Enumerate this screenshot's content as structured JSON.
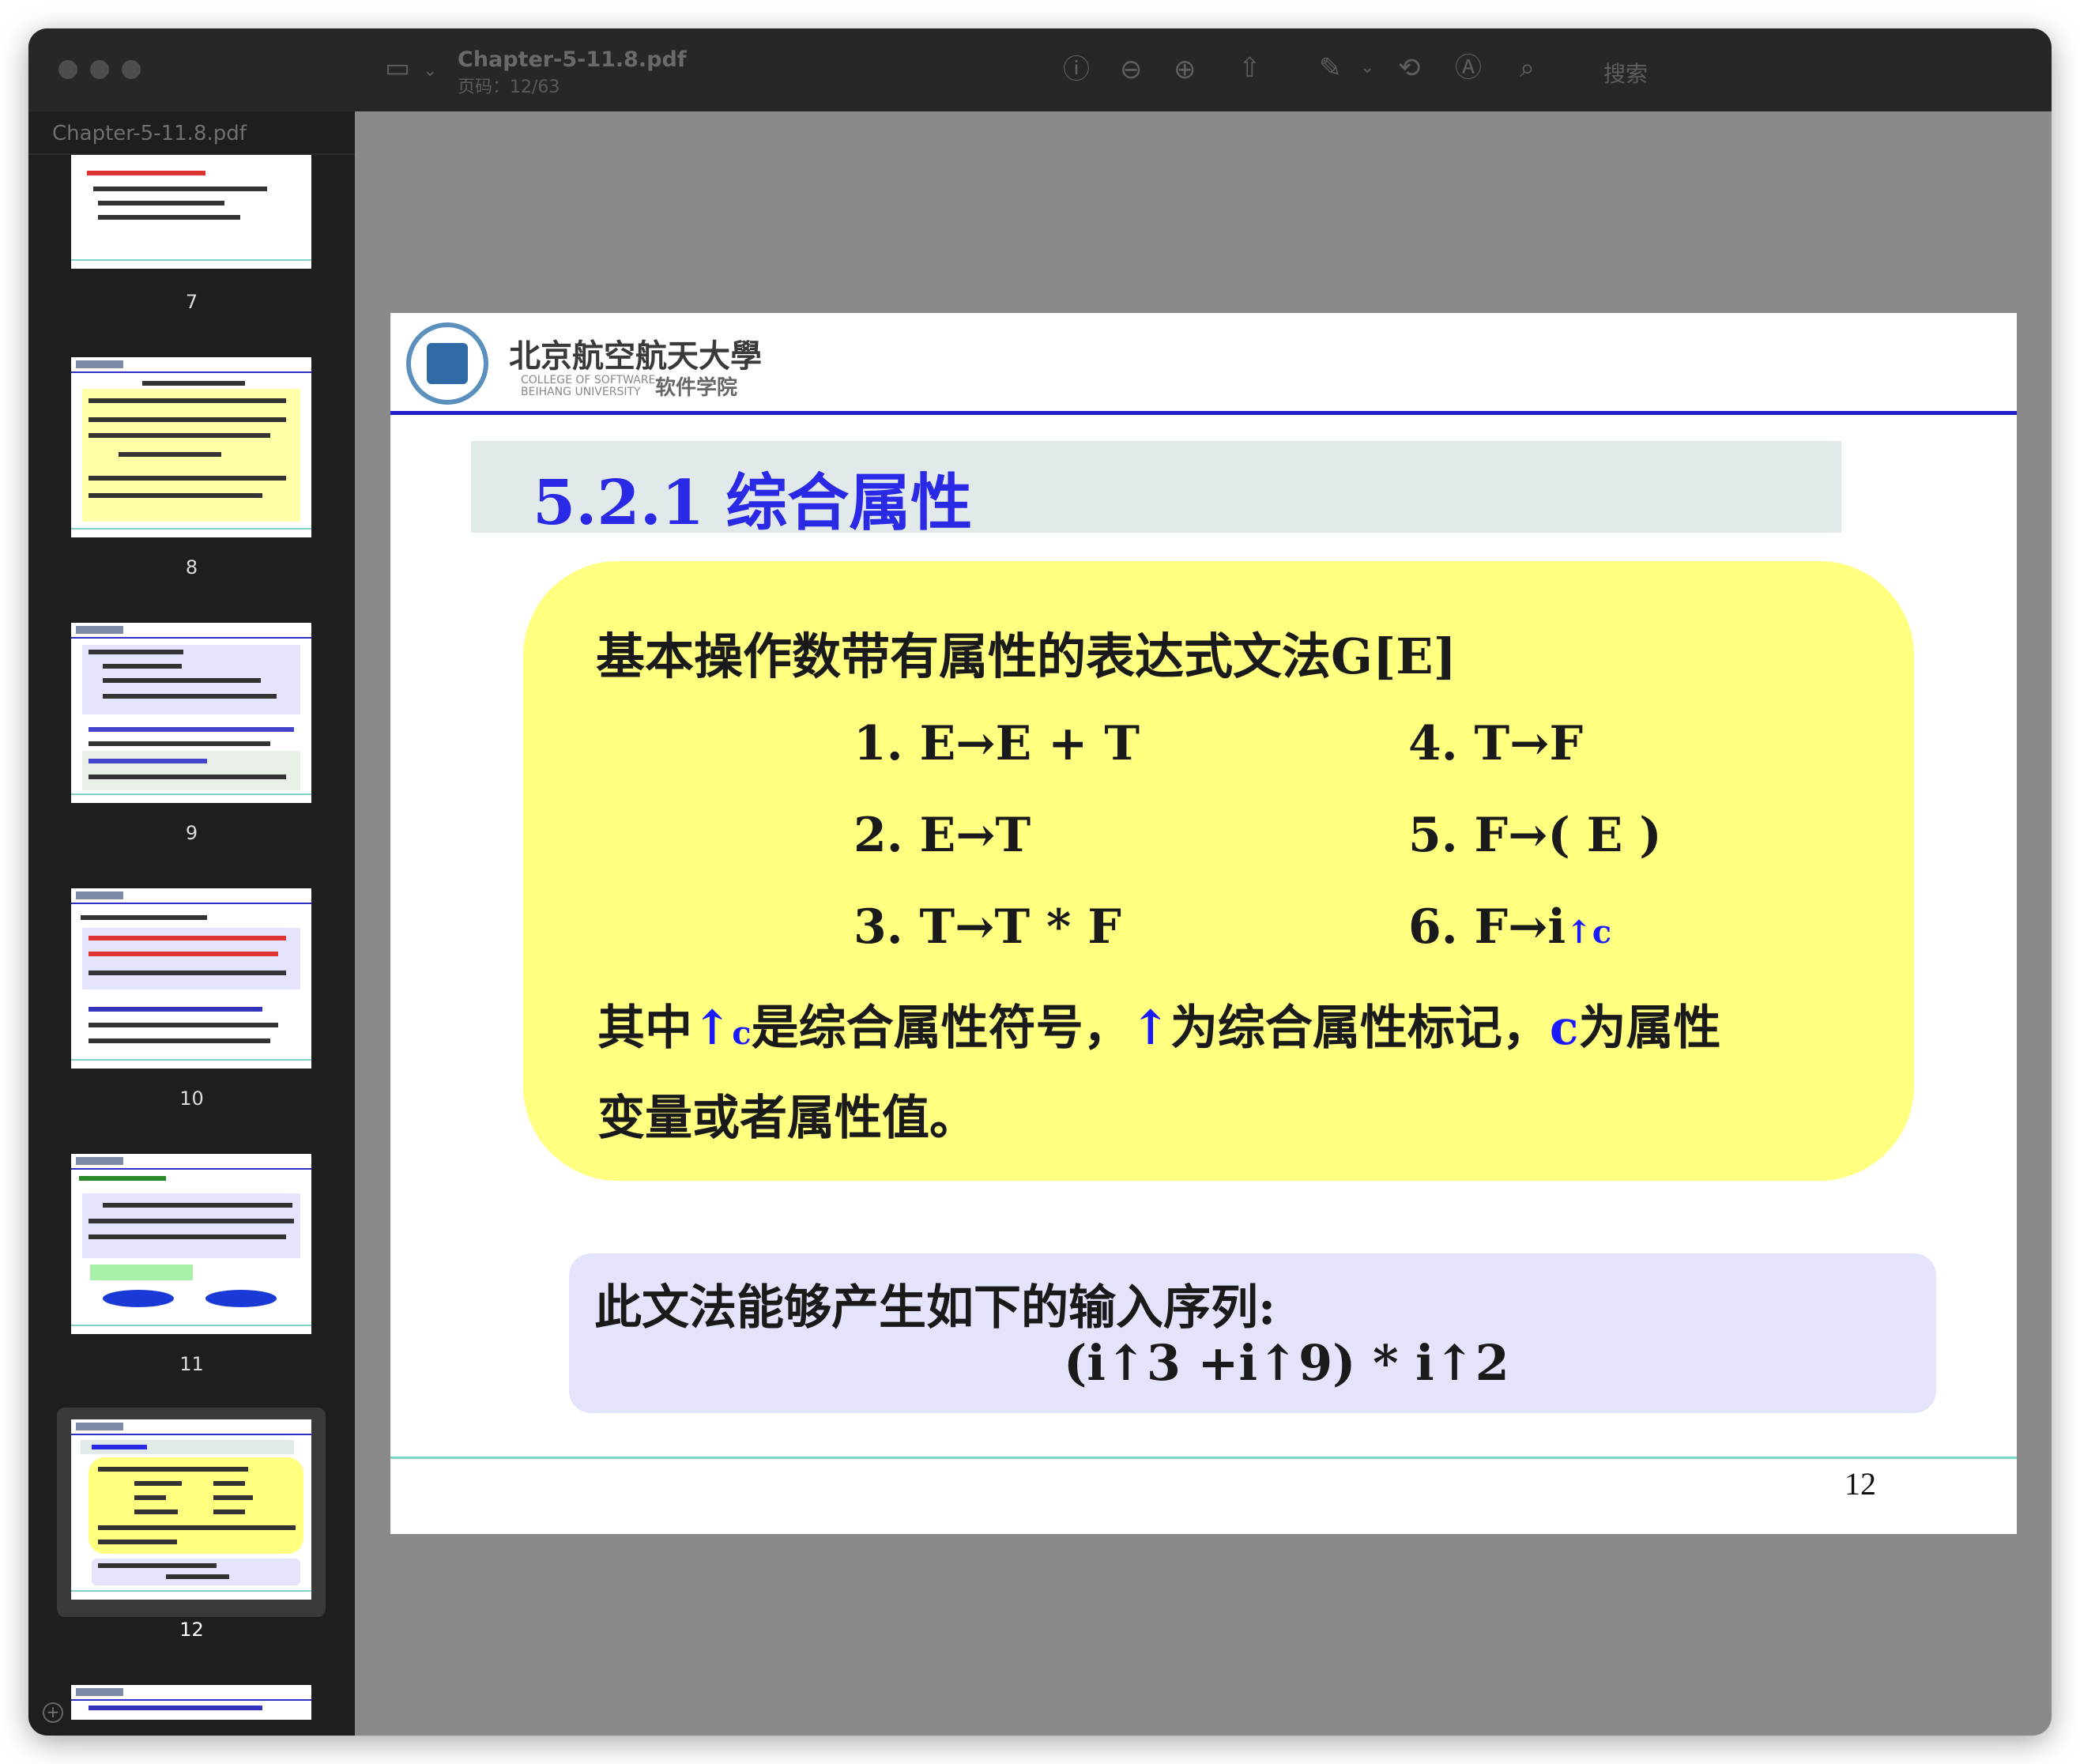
{
  "window": {
    "sidebar_title": "Chapter-5-11.8.pdf",
    "doc_title": "Chapter-5-11.8.pdf",
    "doc_subtitle": "页码：12/63",
    "search_placeholder": "搜索"
  },
  "toolbar": {
    "icons": [
      "sidebar-icon",
      "info-icon",
      "zoom-out-icon",
      "zoom-in-icon",
      "share-icon",
      "highlight-icon",
      "chevron-down-icon",
      "rotate-icon",
      "markup-icon",
      "search-icon"
    ]
  },
  "thumbnails": [
    {
      "label": "7"
    },
    {
      "label": "8"
    },
    {
      "label": "9"
    },
    {
      "label": "10"
    },
    {
      "label": "11"
    },
    {
      "label": "12"
    }
  ],
  "slide": {
    "logo_cn": "北京航空航天大學",
    "logo_en_1": "COLLEGE OF SOFTWARE",
    "logo_en_2": "BEIHANG UNIVERSITY",
    "logo_sw": "软件学院",
    "title": "5.2.1  综合属性",
    "heading": "基本操作数带有属性的表达式文法G[E]",
    "productions": [
      "1. E→E + T",
      "2. E→T",
      "3. T→T * F",
      "4. T→F",
      "5. F→( E )",
      "6. F→i"
    ],
    "prod6_suffix": "↑c",
    "desc1_a": "其中",
    "desc1_b": "↑",
    "desc1_c": "c",
    "desc1_d": "是综合属性符号，",
    "desc1_e": "↑",
    "desc1_f": "为综合属性标记，",
    "desc1_g": "c",
    "desc1_h": "为属性",
    "desc2": "变量或者属性值。",
    "box_text": "此文法能够产生如下的输入序列:",
    "sequence": "(i↑3 +i↑9) * i↑2",
    "page_number": "12"
  },
  "colors": {
    "title_blue": "#2a2ae6",
    "yellow_box": "#ffff80",
    "lavender_box": "#e3e3fb",
    "header_line": "#2020c8"
  }
}
